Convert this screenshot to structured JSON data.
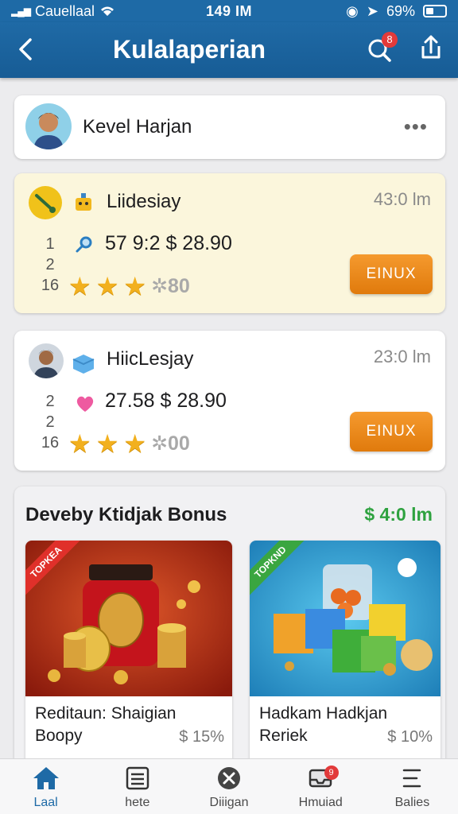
{
  "status": {
    "carrier": "Cauellaal",
    "time": "149 IM",
    "battery": "69%"
  },
  "header": {
    "title": "Kulalaperian",
    "notif_count": "8"
  },
  "user": {
    "name": "Kevel Harjan"
  },
  "offers": [
    {
      "title": "Liidesiay",
      "time": "43:0 lm",
      "ranks": [
        "1",
        "2",
        "16"
      ],
      "price": "57 9:2  $ 28.90",
      "stars_extra": "80",
      "cta": "EINUX"
    },
    {
      "title": "HiicLesjay",
      "time": "23:0 lm",
      "ranks": [
        "2",
        "2",
        "16"
      ],
      "price": "27.58  $ 28.90",
      "stars_extra": "00",
      "cta": "EINUX"
    }
  ],
  "bonus": {
    "title": "Deveby Ktidjak Bonus",
    "amount": "$ 4:0 lm",
    "products": [
      {
        "name": "Reditaun: Shaigian Boopy",
        "discount": "$ 15%",
        "ribbon": "TOPKEA"
      },
      {
        "name": "Hadkam Hadkjan Reriek",
        "discount": "$ 10%",
        "ribbon": "TOPKND"
      }
    ]
  },
  "tabs": [
    {
      "label": "Laal",
      "icon": "home-icon"
    },
    {
      "label": "hete",
      "icon": "list-icon"
    },
    {
      "label": "Diiigan",
      "icon": "close-circle-icon"
    },
    {
      "label": "Hmuiad",
      "icon": "inbox-icon",
      "badge": "9"
    },
    {
      "label": "Balies",
      "icon": "menu-icon"
    }
  ],
  "colors": {
    "primary": "#1e6aa6",
    "accent": "#e07a0c",
    "bonus": "#2ea23f",
    "star": "#f2b01e"
  }
}
